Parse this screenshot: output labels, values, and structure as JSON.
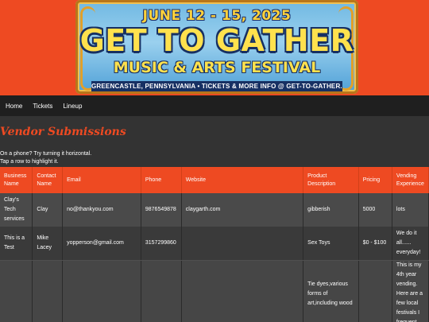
{
  "banner": {
    "dates": "JUNE 12 - 15, 2025",
    "headline": "GET TO GATHER",
    "subhead": "MUSIC & ARTS FESTIVAL",
    "info": "GREENCASTLE, PENNSYLVANIA • TICKETS & MORE INFO @ GET-TO-GATHER.ORG",
    "colors": {
      "background": "#ee4a22",
      "text": "#ffe14d",
      "outline": "#173063"
    }
  },
  "nav": {
    "items": [
      {
        "label": "Home"
      },
      {
        "label": "Tickets"
      },
      {
        "label": "Lineup"
      }
    ]
  },
  "page": {
    "title": "Vendor Submissions",
    "hint_line1": "On a phone? Try turning it horizontal.",
    "hint_line2": "Tap a row to highlight it.",
    "accent": "#ee4a22"
  },
  "table": {
    "headers": [
      "Business Name",
      "Contact Name",
      "Email",
      "Phone",
      "Website",
      "Product Description",
      "Pricing",
      "Vending Experience"
    ],
    "rows": [
      {
        "business": "Clay's Tech services",
        "contact": "Clay",
        "email": "no@thankyou.com",
        "phone": "9876549878",
        "website": "claygarth.com",
        "product": "gibberish",
        "pricing": "5000",
        "experience": "lots"
      },
      {
        "business": "This is a Test",
        "contact": "Mike Lacey",
        "email": "yopperson@gmail.com",
        "phone": "3157299860",
        "website": "",
        "product": "Sex Toys",
        "pricing": "$0 - $100",
        "experience": "We do it all...... everyday!"
      },
      {
        "business": "",
        "contact": "",
        "email": "",
        "phone": "",
        "website": "",
        "product": "Tie dyes,various forms of art,including wood",
        "pricing": "",
        "experience": "This is my 4th year vending. Here are a few local festivals I frequent"
      }
    ]
  }
}
